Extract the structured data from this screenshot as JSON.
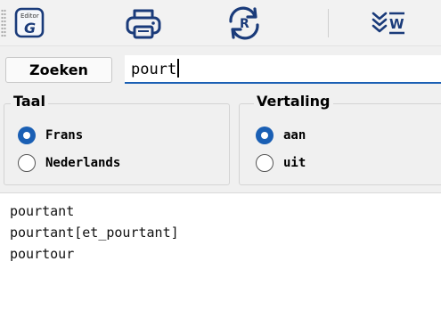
{
  "toolbar": {
    "tools": [
      {
        "icon": "editor-g-icon",
        "badge": "Editor",
        "letter": "G"
      },
      {
        "icon": "printer-icon"
      },
      {
        "icon": "sync-r-icon",
        "letter": "R"
      },
      {
        "icon": "word-chevrons-icon",
        "letter": "W"
      }
    ]
  },
  "search": {
    "button_label": "Zoeken",
    "value": "pourt"
  },
  "taal": {
    "title": "Taal",
    "options": [
      {
        "label": "Frans",
        "checked": true
      },
      {
        "label": "Nederlands",
        "checked": false
      }
    ]
  },
  "vertaling": {
    "title": "Vertaling",
    "options": [
      {
        "label": "aan",
        "checked": true
      },
      {
        "label": "uit",
        "checked": false
      }
    ]
  },
  "results": [
    "pourtant",
    "pourtant[et_pourtant]",
    "pourtour"
  ],
  "colors": {
    "accent": "#1a5fb4",
    "icon_navy": "#1a3b7a",
    "background": "#f0f0f0"
  }
}
